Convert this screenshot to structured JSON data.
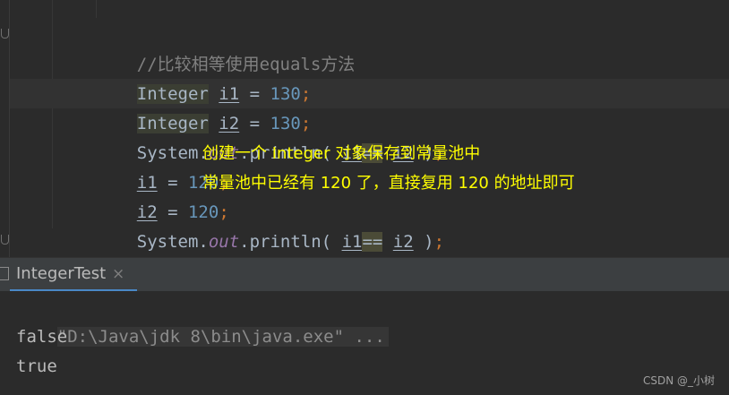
{
  "editor": {
    "comment": "//比较相等使用equals方法",
    "type_name": "Integer",
    "var_i1": "i1",
    "var_i2": "i2",
    "eq": " = ",
    "val_130": "130",
    "val_120": "120",
    "semicolon": ";",
    "system": "System.",
    "out": "out",
    "println_open": ".println( ",
    "eqeq": "==",
    "space": " ",
    "close_paren": " )",
    "closing_brace": "}"
  },
  "annotations": {
    "line1": "创建一个 Integer 对象保存到常量池中",
    "line2": "常量池中已经有 120 了，直接复用 120 的地址即可"
  },
  "run_panel": {
    "tab_label": "IntegerTest",
    "close_glyph": "×"
  },
  "console": {
    "command": "\"D:\\Java\\jdk 8\\bin\\java.exe\" ...",
    "output_1": "false",
    "output_2": "true"
  },
  "watermark": "CSDN @_小树",
  "colors": {
    "background": "#2b2b2b",
    "keyword": "#cc7832",
    "number": "#6897bb",
    "static_field": "#9876aa",
    "comment": "#808080",
    "annotation": "#ffff00",
    "tab_underline": "#4a88c7"
  }
}
